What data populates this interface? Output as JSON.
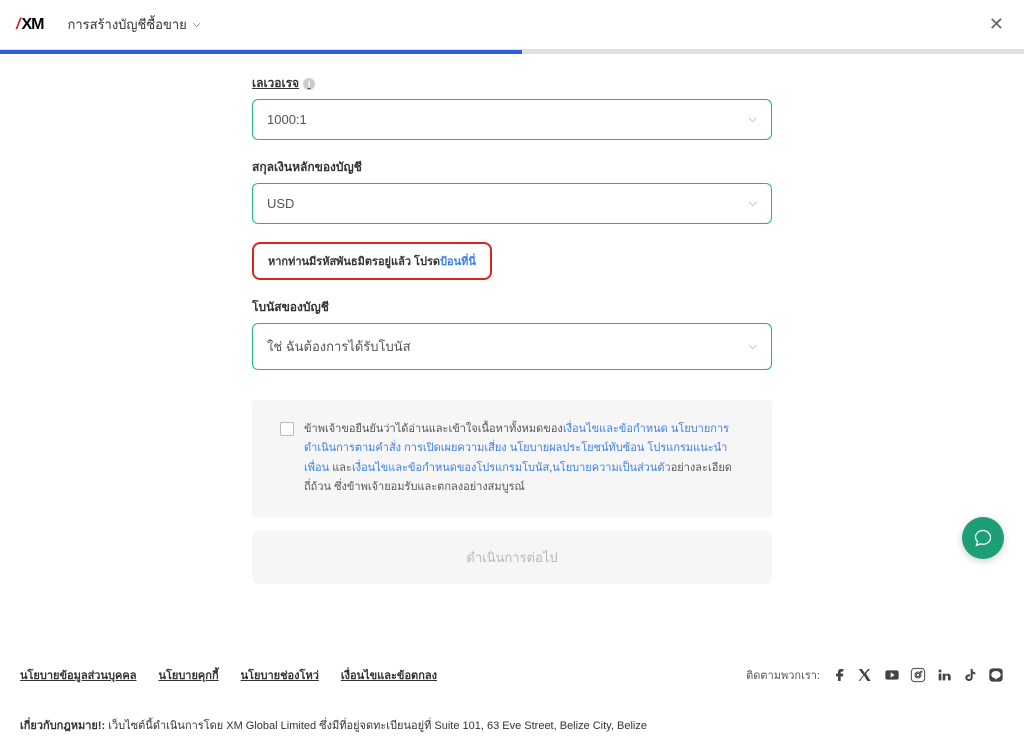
{
  "header": {
    "logo_text": "XM",
    "page_title": "การสร้างบัญชีซื้อขาย"
  },
  "progress": {
    "percent": 51
  },
  "fields": {
    "leverage": {
      "label": "เลเวอเรจ",
      "value": "1000:1"
    },
    "currency": {
      "label": "สกุลเงินหลักของบัญชี",
      "value": "USD"
    },
    "partner_prompt": {
      "text": "หากท่านมีรหัสพันธมิตรอยู่แล้ว โปรด",
      "link": "ป้อนที่นี่"
    },
    "bonus": {
      "label": "โบนัสของบัญชี",
      "value": "ใช่ ฉันต้องการได้รับโบนัส"
    }
  },
  "agreement": {
    "part1": "ข้าพเจ้าขอยืนยันว่าได้อ่านและเข้าใจเนื้อหาทั้งหมดของ",
    "link1": "เงื่อนไขและข้อกำหนด",
    "part2": " ",
    "link2": "นโยบายการดำเนินการตามคำสั่ง",
    "part3": " ",
    "link3": "การเปิดเผยความเสี่ยง",
    "part4": " ",
    "link4": "นโยบายผลประโยชน์ทับซ้อน",
    "part5": " ",
    "link5": "โปรแกรมแนะนำเพื่อน",
    "part6": " และ",
    "link6": "เงื่อนไขและข้อกำหนดของโปรแกรมโบนัส",
    "part7": ",",
    "link7": "นโยบายความเป็นส่วนตัว",
    "part8": "อย่างละเอียดถี่ถ้วน ซึ่งข้าพเจ้ายอมรับและตกลงอย่างสมบูรณ์"
  },
  "continue_label": "ดำเนินการต่อไป",
  "footer": {
    "links": {
      "privacy": "นโยบายข้อมูลส่วนบุคคล",
      "cookies": "นโยบายคุกกี้",
      "vulnerability": "นโยบายช่องโหว่",
      "terms": "เงื่อนไขและข้อตกลง"
    },
    "social_label": "ติดตามพวกเรา:",
    "legal_prefix": "เกี่ยวกับกฎหมาย!:",
    "legal_text": " เว็บไซต์นี้ดำเนินการโดย XM Global Limited ซึ่งมีที่อยู่จดทะเบียนอยู่ที่ Suite 101, 63 Eve Street, Belize City, Belize"
  }
}
